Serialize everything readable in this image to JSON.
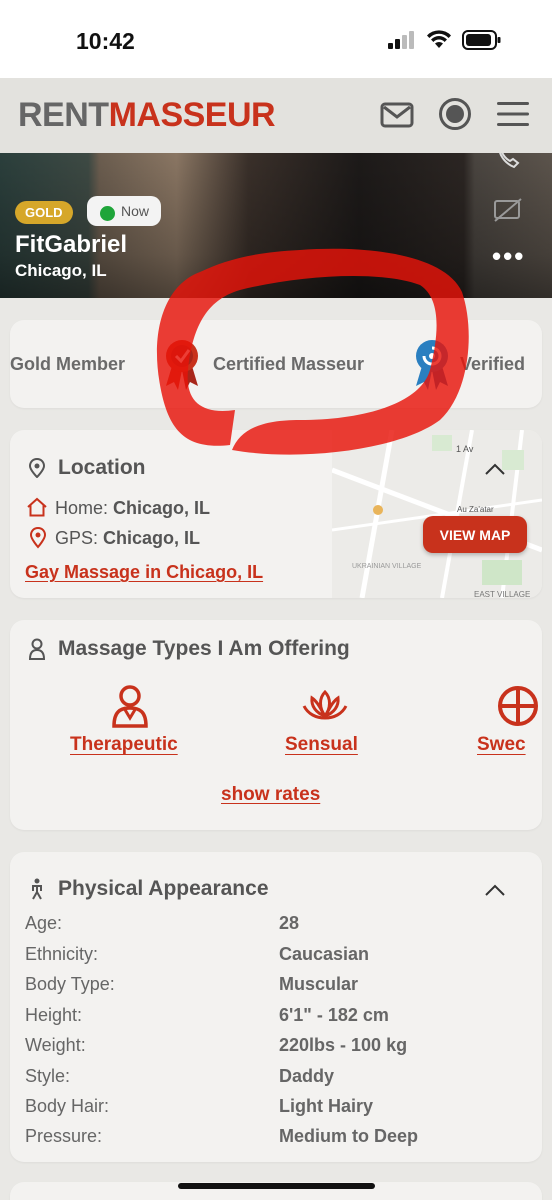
{
  "status_bar": {
    "time": "10:42"
  },
  "header": {
    "logo_part1": "RENT",
    "logo_part2": "MASSEUR",
    "icons": [
      "mail-icon",
      "record-icon",
      "menu-icon"
    ]
  },
  "hero": {
    "level_badge": "GOLD",
    "status_label": "Now",
    "name": "FitGabriel",
    "city": "Chicago, IL",
    "more": "•••"
  },
  "member_badges": {
    "gold": "Gold Member",
    "certified": "Certified Masseur",
    "verified": "Verified"
  },
  "location": {
    "title": "Location",
    "home_label": "Home:",
    "home_value": "Chicago, IL",
    "gps_label": "GPS:",
    "gps_value": "Chicago, IL",
    "link": "Gay Massage in Chicago, IL",
    "view_map": "VIEW MAP",
    "map_labels": {
      "subway": "1 Av",
      "place": "Au Za'atar",
      "village": "UKRAINIAN VILLAGE",
      "east_village": "EAST VILLAGE"
    }
  },
  "massage_types": {
    "title": "Massage Types I Am Offering",
    "items": [
      "Therapeutic",
      "Sensual",
      "Swec"
    ],
    "show_rates": "show rates"
  },
  "appearance": {
    "title": "Physical Appearance",
    "rows": [
      {
        "label": "Age:",
        "value": "28"
      },
      {
        "label": "Ethnicity:",
        "value": "Caucasian"
      },
      {
        "label": "Body Type:",
        "value": "Muscular"
      },
      {
        "label": "Height:",
        "value": "6'1\" - 182 cm"
      },
      {
        "label": "Weight:",
        "value": "220lbs - 100 kg"
      },
      {
        "label": "Style:",
        "value": "Daddy"
      },
      {
        "label": "Body Hair:",
        "value": "Light Hairy"
      },
      {
        "label": "Pressure:",
        "value": "Medium to Deep"
      }
    ]
  },
  "colors": {
    "brand_red": "#c8321c",
    "gold": "#d6a72a",
    "online_green": "#1fa53a",
    "verified_blue": "#2a7fc0"
  }
}
